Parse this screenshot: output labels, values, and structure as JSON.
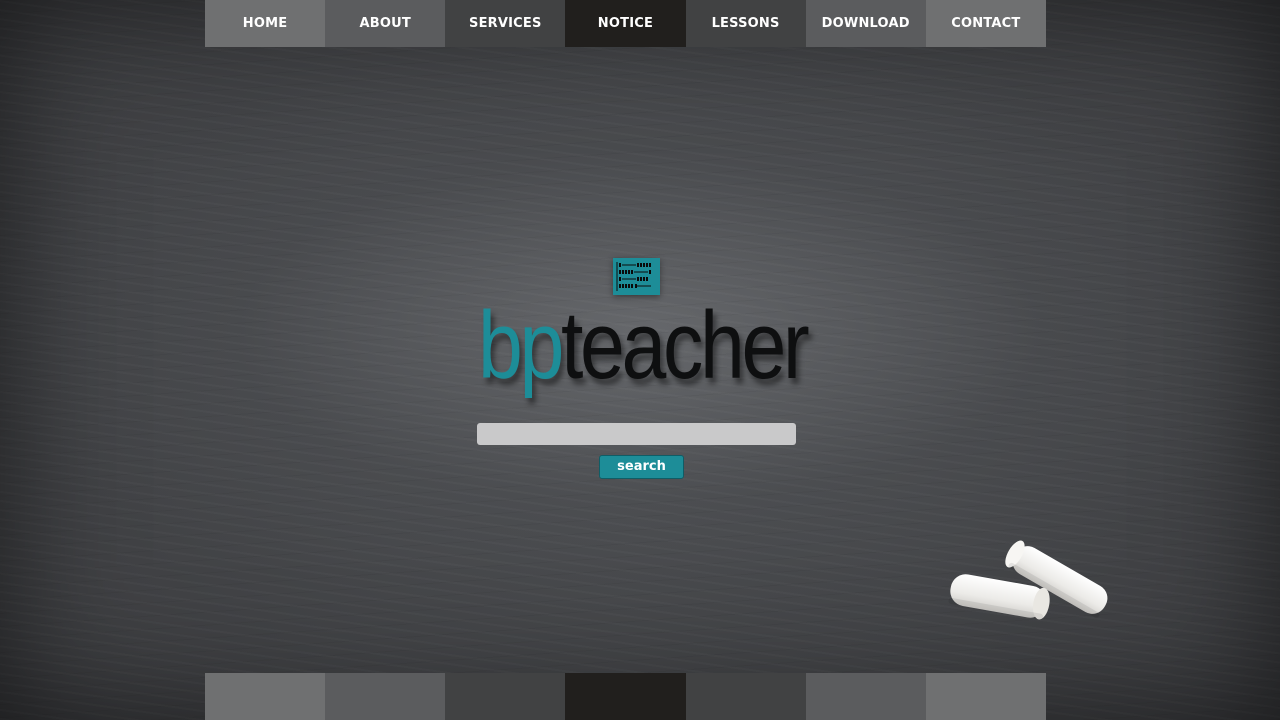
{
  "nav": {
    "items": [
      {
        "label": "HOME"
      },
      {
        "label": "ABOUT"
      },
      {
        "label": "SERVICES"
      },
      {
        "label": "NOTICE"
      },
      {
        "label": "LESSONS"
      },
      {
        "label": "DOWNLOAD"
      },
      {
        "label": "CONTACT"
      }
    ]
  },
  "brand": {
    "prefix": "bp",
    "suffix": "teacher",
    "logo_icon": "abacus-icon"
  },
  "search": {
    "placeholder": "",
    "value": "",
    "button_label": "search"
  },
  "decor": {
    "chalk": "chalk-pieces"
  },
  "colors": {
    "accent": "#1d8d98",
    "brand_dark": "#0e0f10",
    "nav_light": "#6f7071",
    "nav_mid": "#5b5c5e",
    "nav_dark": "#414243",
    "nav_darkest": "#211f1d",
    "input_bg": "#c9c9ca"
  }
}
